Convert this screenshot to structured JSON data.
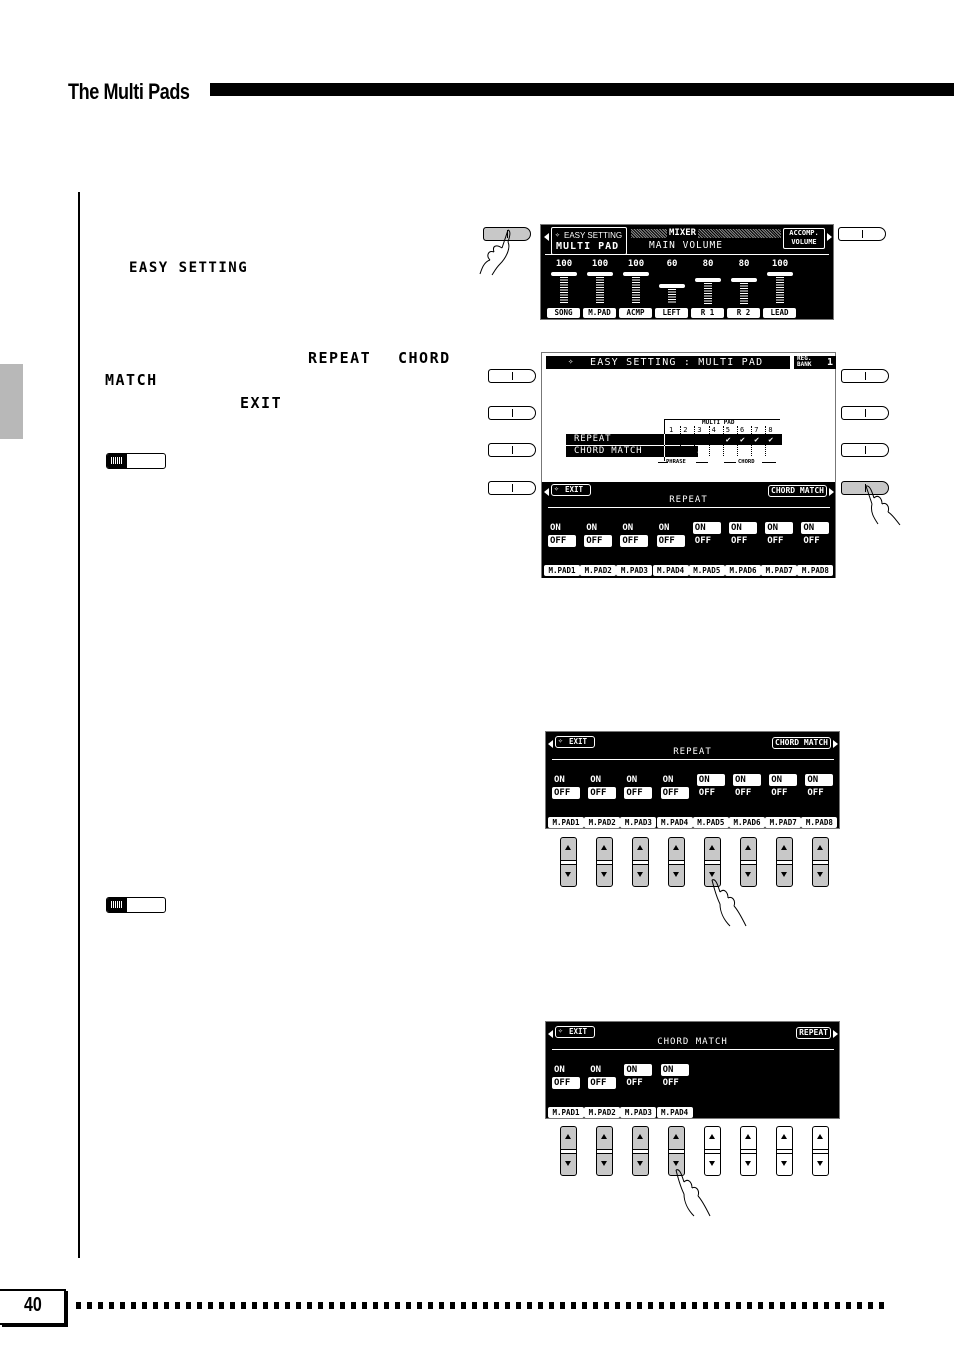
{
  "header": {
    "title": "The Multi Pads"
  },
  "body_keywords": {
    "easy_setting": "EASY SETTING",
    "repeat": "REPEAT",
    "chord": "CHORD",
    "match": "MATCH",
    "exit": "EXIT"
  },
  "screen1_mixer": {
    "easy_setting_label": "EASY SETTING",
    "multi_pad_label": "MULTI PAD",
    "mixer_label": "MIXER",
    "main_volume_label": "MAIN VOLUME",
    "accomp_volume_line1": "ACCOMP.",
    "accomp_volume_line2": "VOLUME",
    "channels": [
      {
        "name": "SONG",
        "value": "100"
      },
      {
        "name": "M.PAD",
        "value": "100"
      },
      {
        "name": "ACMP",
        "value": "100"
      },
      {
        "name": "LEFT",
        "value": "60"
      },
      {
        "name": "R 1",
        "value": "80"
      },
      {
        "name": "R 2",
        "value": "80"
      },
      {
        "name": "LEAD",
        "value": "100"
      }
    ]
  },
  "screen2_easy_setting": {
    "title": "EASY SETTING : MULTI PAD",
    "reg_bank_line1": "REG.",
    "reg_bank_line2": "BANK",
    "reg_bank_value": "1",
    "table_header": "MULTI PAD",
    "pad_numbers": [
      "1",
      "2",
      "3",
      "4",
      "5",
      "6",
      "7",
      "8"
    ],
    "rows": [
      {
        "label": "REPEAT",
        "checks": [
          false,
          false,
          false,
          false,
          true,
          true,
          true,
          true
        ]
      },
      {
        "label": "CHORD MATCH",
        "checks": [
          false,
          false,
          true,
          true
        ]
      }
    ],
    "check_glyph": "✔",
    "group_phrase": "PHRASE",
    "group_chord": "CHORD"
  },
  "repeat_screen": {
    "exit_label": "EXIT",
    "title": "REPEAT",
    "next_label": "CHORD MATCH",
    "on_label": "ON",
    "off_label": "OFF",
    "pads": [
      {
        "name": "M.PAD1",
        "state": "OFF"
      },
      {
        "name": "M.PAD2",
        "state": "OFF"
      },
      {
        "name": "M.PAD3",
        "state": "OFF"
      },
      {
        "name": "M.PAD4",
        "state": "OFF"
      },
      {
        "name": "M.PAD5",
        "state": "ON"
      },
      {
        "name": "M.PAD6",
        "state": "ON"
      },
      {
        "name": "M.PAD7",
        "state": "ON"
      },
      {
        "name": "M.PAD8",
        "state": "ON"
      }
    ]
  },
  "chord_match_screen": {
    "exit_label": "EXIT",
    "title": "CHORD MATCH",
    "next_label": "REPEAT",
    "on_label": "ON",
    "off_label": "OFF",
    "pads": [
      {
        "name": "M.PAD1",
        "state": "OFF"
      },
      {
        "name": "M.PAD2",
        "state": "OFF"
      },
      {
        "name": "M.PAD3",
        "state": "ON"
      },
      {
        "name": "M.PAD4",
        "state": "ON"
      }
    ]
  },
  "footer": {
    "page_number": "40"
  }
}
